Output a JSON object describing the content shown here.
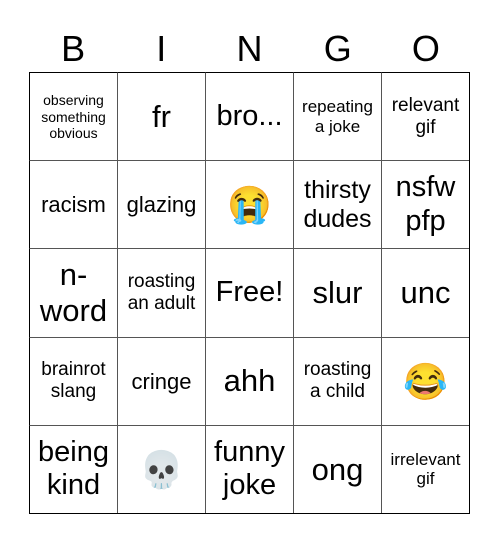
{
  "header": {
    "letters": [
      "B",
      "I",
      "N",
      "G",
      "O"
    ]
  },
  "cells": [
    {
      "text": "observing something obvious",
      "kind": "text"
    },
    {
      "text": "fr",
      "kind": "text"
    },
    {
      "text": "bro...",
      "kind": "text"
    },
    {
      "text": "repeating a joke",
      "kind": "text"
    },
    {
      "text": "relevant gif",
      "kind": "text"
    },
    {
      "text": "racism",
      "kind": "text"
    },
    {
      "text": "glazing",
      "kind": "text"
    },
    {
      "text": "😭",
      "kind": "emoji",
      "icon": "loudly-crying-face-icon"
    },
    {
      "text": "thirsty dudes",
      "kind": "text"
    },
    {
      "text": "nsfw pfp",
      "kind": "text"
    },
    {
      "text": "n-word",
      "kind": "text"
    },
    {
      "text": "roasting an adult",
      "kind": "text"
    },
    {
      "text": "Free!",
      "kind": "free"
    },
    {
      "text": "slur",
      "kind": "text"
    },
    {
      "text": "unc",
      "kind": "text"
    },
    {
      "text": "brainrot slang",
      "kind": "text"
    },
    {
      "text": "cringe",
      "kind": "text"
    },
    {
      "text": "ahh",
      "kind": "text"
    },
    {
      "text": "roasting a child",
      "kind": "text"
    },
    {
      "text": "😂",
      "kind": "emoji",
      "icon": "tears-of-joy-face-icon"
    },
    {
      "text": "being kind",
      "kind": "text"
    },
    {
      "text": "💀",
      "kind": "emoji",
      "icon": "skull-icon"
    },
    {
      "text": "funny joke",
      "kind": "text"
    },
    {
      "text": "ong",
      "kind": "text"
    },
    {
      "text": "irrelevant gif",
      "kind": "text"
    }
  ]
}
